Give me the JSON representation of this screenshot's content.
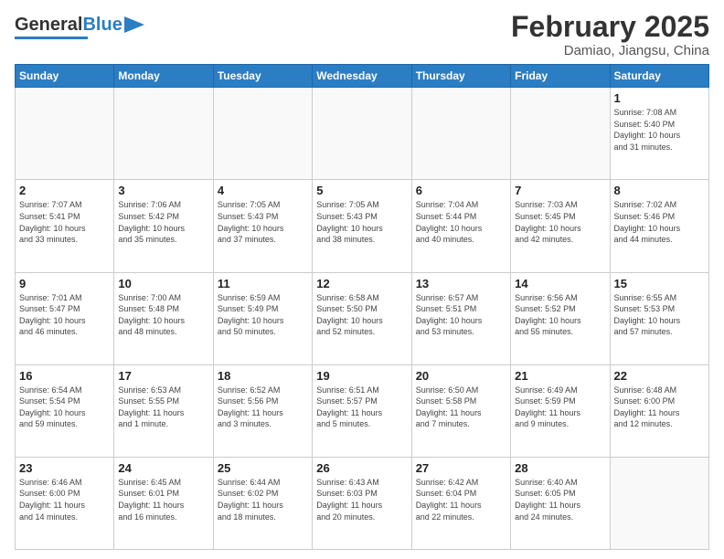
{
  "logo": {
    "general": "General",
    "blue": "Blue"
  },
  "header": {
    "month": "February 2025",
    "location": "Damiao, Jiangsu, China"
  },
  "weekdays": [
    "Sunday",
    "Monday",
    "Tuesday",
    "Wednesday",
    "Thursday",
    "Friday",
    "Saturday"
  ],
  "weeks": [
    [
      {
        "day": "",
        "info": ""
      },
      {
        "day": "",
        "info": ""
      },
      {
        "day": "",
        "info": ""
      },
      {
        "day": "",
        "info": ""
      },
      {
        "day": "",
        "info": ""
      },
      {
        "day": "",
        "info": ""
      },
      {
        "day": "1",
        "info": "Sunrise: 7:08 AM\nSunset: 5:40 PM\nDaylight: 10 hours\nand 31 minutes."
      }
    ],
    [
      {
        "day": "2",
        "info": "Sunrise: 7:07 AM\nSunset: 5:41 PM\nDaylight: 10 hours\nand 33 minutes."
      },
      {
        "day": "3",
        "info": "Sunrise: 7:06 AM\nSunset: 5:42 PM\nDaylight: 10 hours\nand 35 minutes."
      },
      {
        "day": "4",
        "info": "Sunrise: 7:05 AM\nSunset: 5:43 PM\nDaylight: 10 hours\nand 37 minutes."
      },
      {
        "day": "5",
        "info": "Sunrise: 7:05 AM\nSunset: 5:43 PM\nDaylight: 10 hours\nand 38 minutes."
      },
      {
        "day": "6",
        "info": "Sunrise: 7:04 AM\nSunset: 5:44 PM\nDaylight: 10 hours\nand 40 minutes."
      },
      {
        "day": "7",
        "info": "Sunrise: 7:03 AM\nSunset: 5:45 PM\nDaylight: 10 hours\nand 42 minutes."
      },
      {
        "day": "8",
        "info": "Sunrise: 7:02 AM\nSunset: 5:46 PM\nDaylight: 10 hours\nand 44 minutes."
      }
    ],
    [
      {
        "day": "9",
        "info": "Sunrise: 7:01 AM\nSunset: 5:47 PM\nDaylight: 10 hours\nand 46 minutes."
      },
      {
        "day": "10",
        "info": "Sunrise: 7:00 AM\nSunset: 5:48 PM\nDaylight: 10 hours\nand 48 minutes."
      },
      {
        "day": "11",
        "info": "Sunrise: 6:59 AM\nSunset: 5:49 PM\nDaylight: 10 hours\nand 50 minutes."
      },
      {
        "day": "12",
        "info": "Sunrise: 6:58 AM\nSunset: 5:50 PM\nDaylight: 10 hours\nand 52 minutes."
      },
      {
        "day": "13",
        "info": "Sunrise: 6:57 AM\nSunset: 5:51 PM\nDaylight: 10 hours\nand 53 minutes."
      },
      {
        "day": "14",
        "info": "Sunrise: 6:56 AM\nSunset: 5:52 PM\nDaylight: 10 hours\nand 55 minutes."
      },
      {
        "day": "15",
        "info": "Sunrise: 6:55 AM\nSunset: 5:53 PM\nDaylight: 10 hours\nand 57 minutes."
      }
    ],
    [
      {
        "day": "16",
        "info": "Sunrise: 6:54 AM\nSunset: 5:54 PM\nDaylight: 10 hours\nand 59 minutes."
      },
      {
        "day": "17",
        "info": "Sunrise: 6:53 AM\nSunset: 5:55 PM\nDaylight: 11 hours\nand 1 minute."
      },
      {
        "day": "18",
        "info": "Sunrise: 6:52 AM\nSunset: 5:56 PM\nDaylight: 11 hours\nand 3 minutes."
      },
      {
        "day": "19",
        "info": "Sunrise: 6:51 AM\nSunset: 5:57 PM\nDaylight: 11 hours\nand 5 minutes."
      },
      {
        "day": "20",
        "info": "Sunrise: 6:50 AM\nSunset: 5:58 PM\nDaylight: 11 hours\nand 7 minutes."
      },
      {
        "day": "21",
        "info": "Sunrise: 6:49 AM\nSunset: 5:59 PM\nDaylight: 11 hours\nand 9 minutes."
      },
      {
        "day": "22",
        "info": "Sunrise: 6:48 AM\nSunset: 6:00 PM\nDaylight: 11 hours\nand 12 minutes."
      }
    ],
    [
      {
        "day": "23",
        "info": "Sunrise: 6:46 AM\nSunset: 6:00 PM\nDaylight: 11 hours\nand 14 minutes."
      },
      {
        "day": "24",
        "info": "Sunrise: 6:45 AM\nSunset: 6:01 PM\nDaylight: 11 hours\nand 16 minutes."
      },
      {
        "day": "25",
        "info": "Sunrise: 6:44 AM\nSunset: 6:02 PM\nDaylight: 11 hours\nand 18 minutes."
      },
      {
        "day": "26",
        "info": "Sunrise: 6:43 AM\nSunset: 6:03 PM\nDaylight: 11 hours\nand 20 minutes."
      },
      {
        "day": "27",
        "info": "Sunrise: 6:42 AM\nSunset: 6:04 PM\nDaylight: 11 hours\nand 22 minutes."
      },
      {
        "day": "28",
        "info": "Sunrise: 6:40 AM\nSunset: 6:05 PM\nDaylight: 11 hours\nand 24 minutes."
      },
      {
        "day": "",
        "info": ""
      }
    ]
  ]
}
